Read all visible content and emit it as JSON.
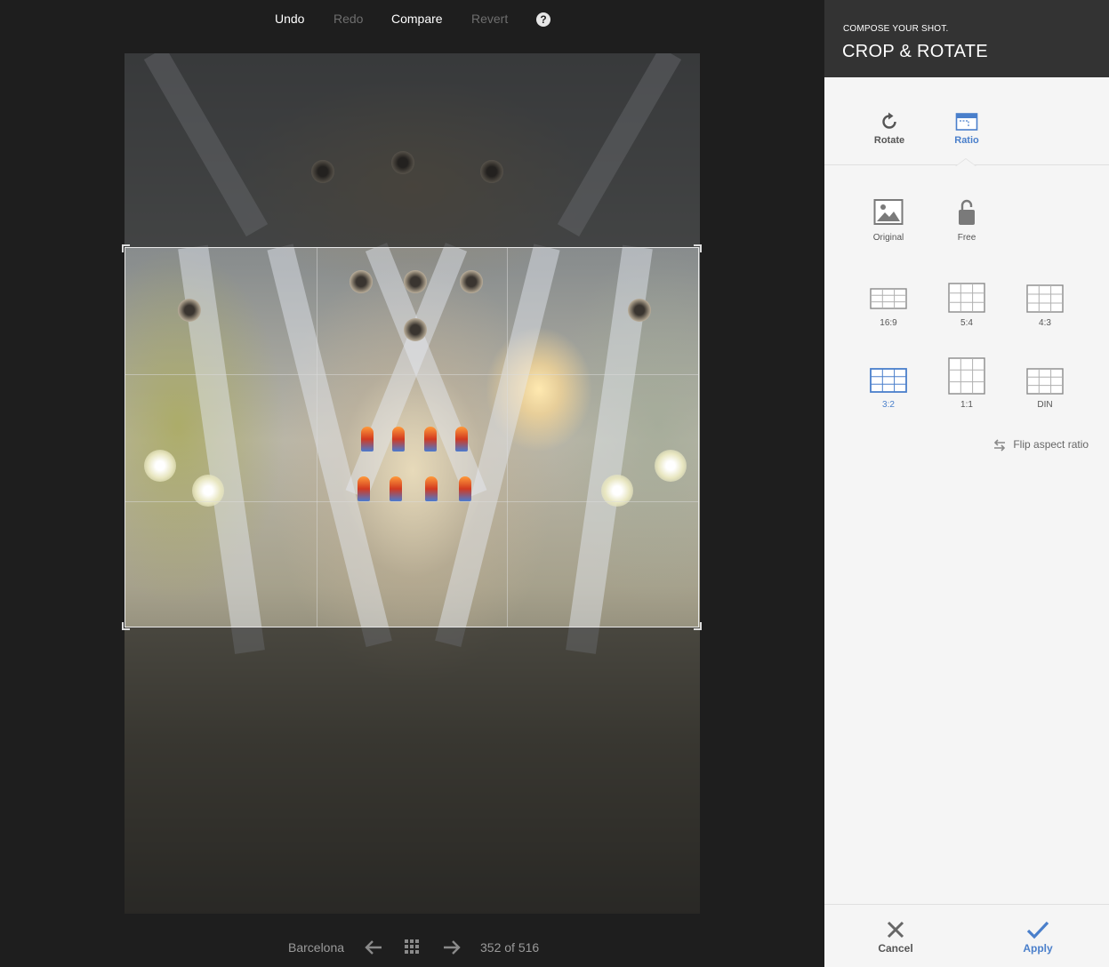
{
  "toolbar": {
    "undo": "Undo",
    "redo": "Redo",
    "compare": "Compare",
    "revert": "Revert",
    "help_icon": "?"
  },
  "panel": {
    "subtitle": "COMPOSE YOUR SHOT.",
    "title": "CROP & ROTATE",
    "tabs": [
      {
        "label": "Rotate",
        "icon": "rotate-icon"
      },
      {
        "label": "Ratio",
        "icon": "ratio-icon",
        "active": true
      }
    ],
    "ratios": [
      {
        "label": "Original",
        "icon": "image-icon"
      },
      {
        "label": "Free",
        "icon": "unlock-icon"
      },
      {
        "label": "16:9"
      },
      {
        "label": "5:4"
      },
      {
        "label": "4:3"
      },
      {
        "label": "3:2",
        "active": true
      },
      {
        "label": "1:1"
      },
      {
        "label": "DIN"
      }
    ],
    "flip_label": "Flip aspect ratio",
    "cancel": "Cancel",
    "apply": "Apply"
  },
  "bottom_bar": {
    "album": "Barcelona",
    "counter": "352 of 516"
  },
  "colors": {
    "accent": "#4a7fcb",
    "panel_header": "#333333",
    "editor_bg": "#1e1e1e"
  }
}
